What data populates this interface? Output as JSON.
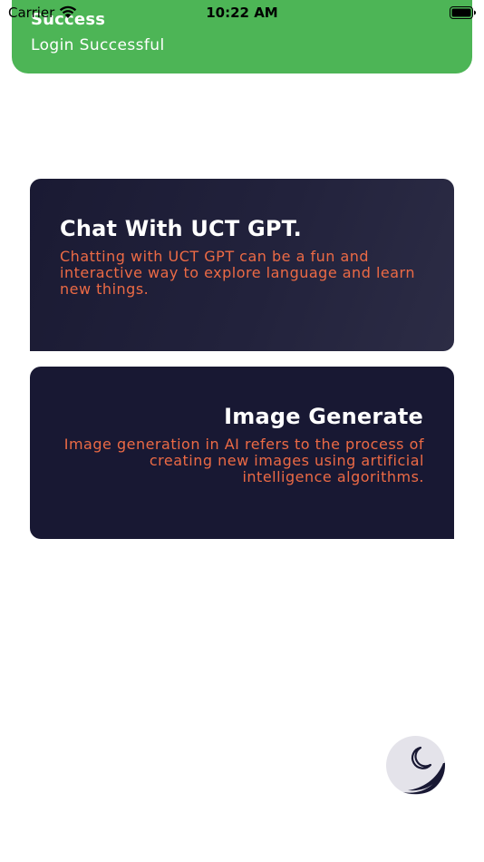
{
  "status_bar": {
    "carrier": "Carrier",
    "time": "10:22 AM"
  },
  "toast": {
    "title": "Success",
    "message": "Login Successful",
    "color": "#4db556"
  },
  "cards": [
    {
      "title": "Chat With UCT GPT.",
      "description": "Chatting with UCT GPT can be a fun and interactive way to explore language and learn new things."
    },
    {
      "title": "Image Generate",
      "description": "Image generation in AI refers to the process of creating new images using artificial intelligence algorithms."
    }
  ],
  "theme_toggle": {
    "icon": "moon-icon"
  },
  "colors": {
    "card_background": "#181833",
    "description_text": "#ec6a45",
    "toggle_background": "#e4e3ea"
  }
}
